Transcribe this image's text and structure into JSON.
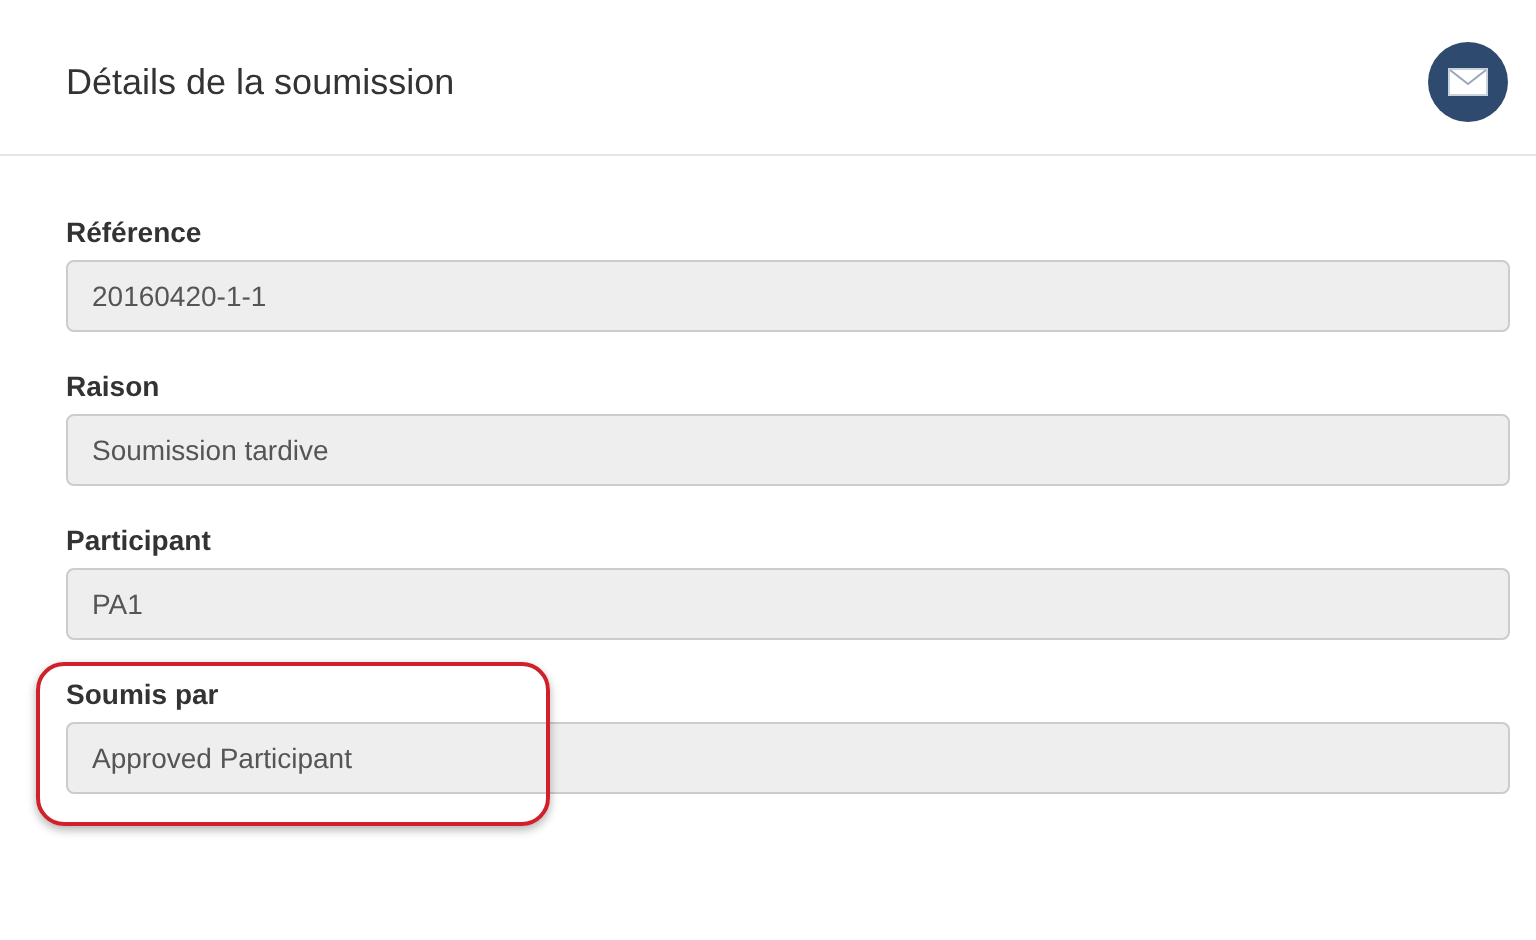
{
  "header": {
    "title": "Détails de la soumission"
  },
  "fields": [
    {
      "label": "Référence",
      "value": "20160420-1-1",
      "highlighted": false
    },
    {
      "label": "Raison",
      "value": "Soumission tardive",
      "highlighted": false
    },
    {
      "label": "Participant",
      "value": "PA1",
      "highlighted": false
    },
    {
      "label": "Soumis par",
      "value": "Approved Participant",
      "highlighted": true
    }
  ]
}
